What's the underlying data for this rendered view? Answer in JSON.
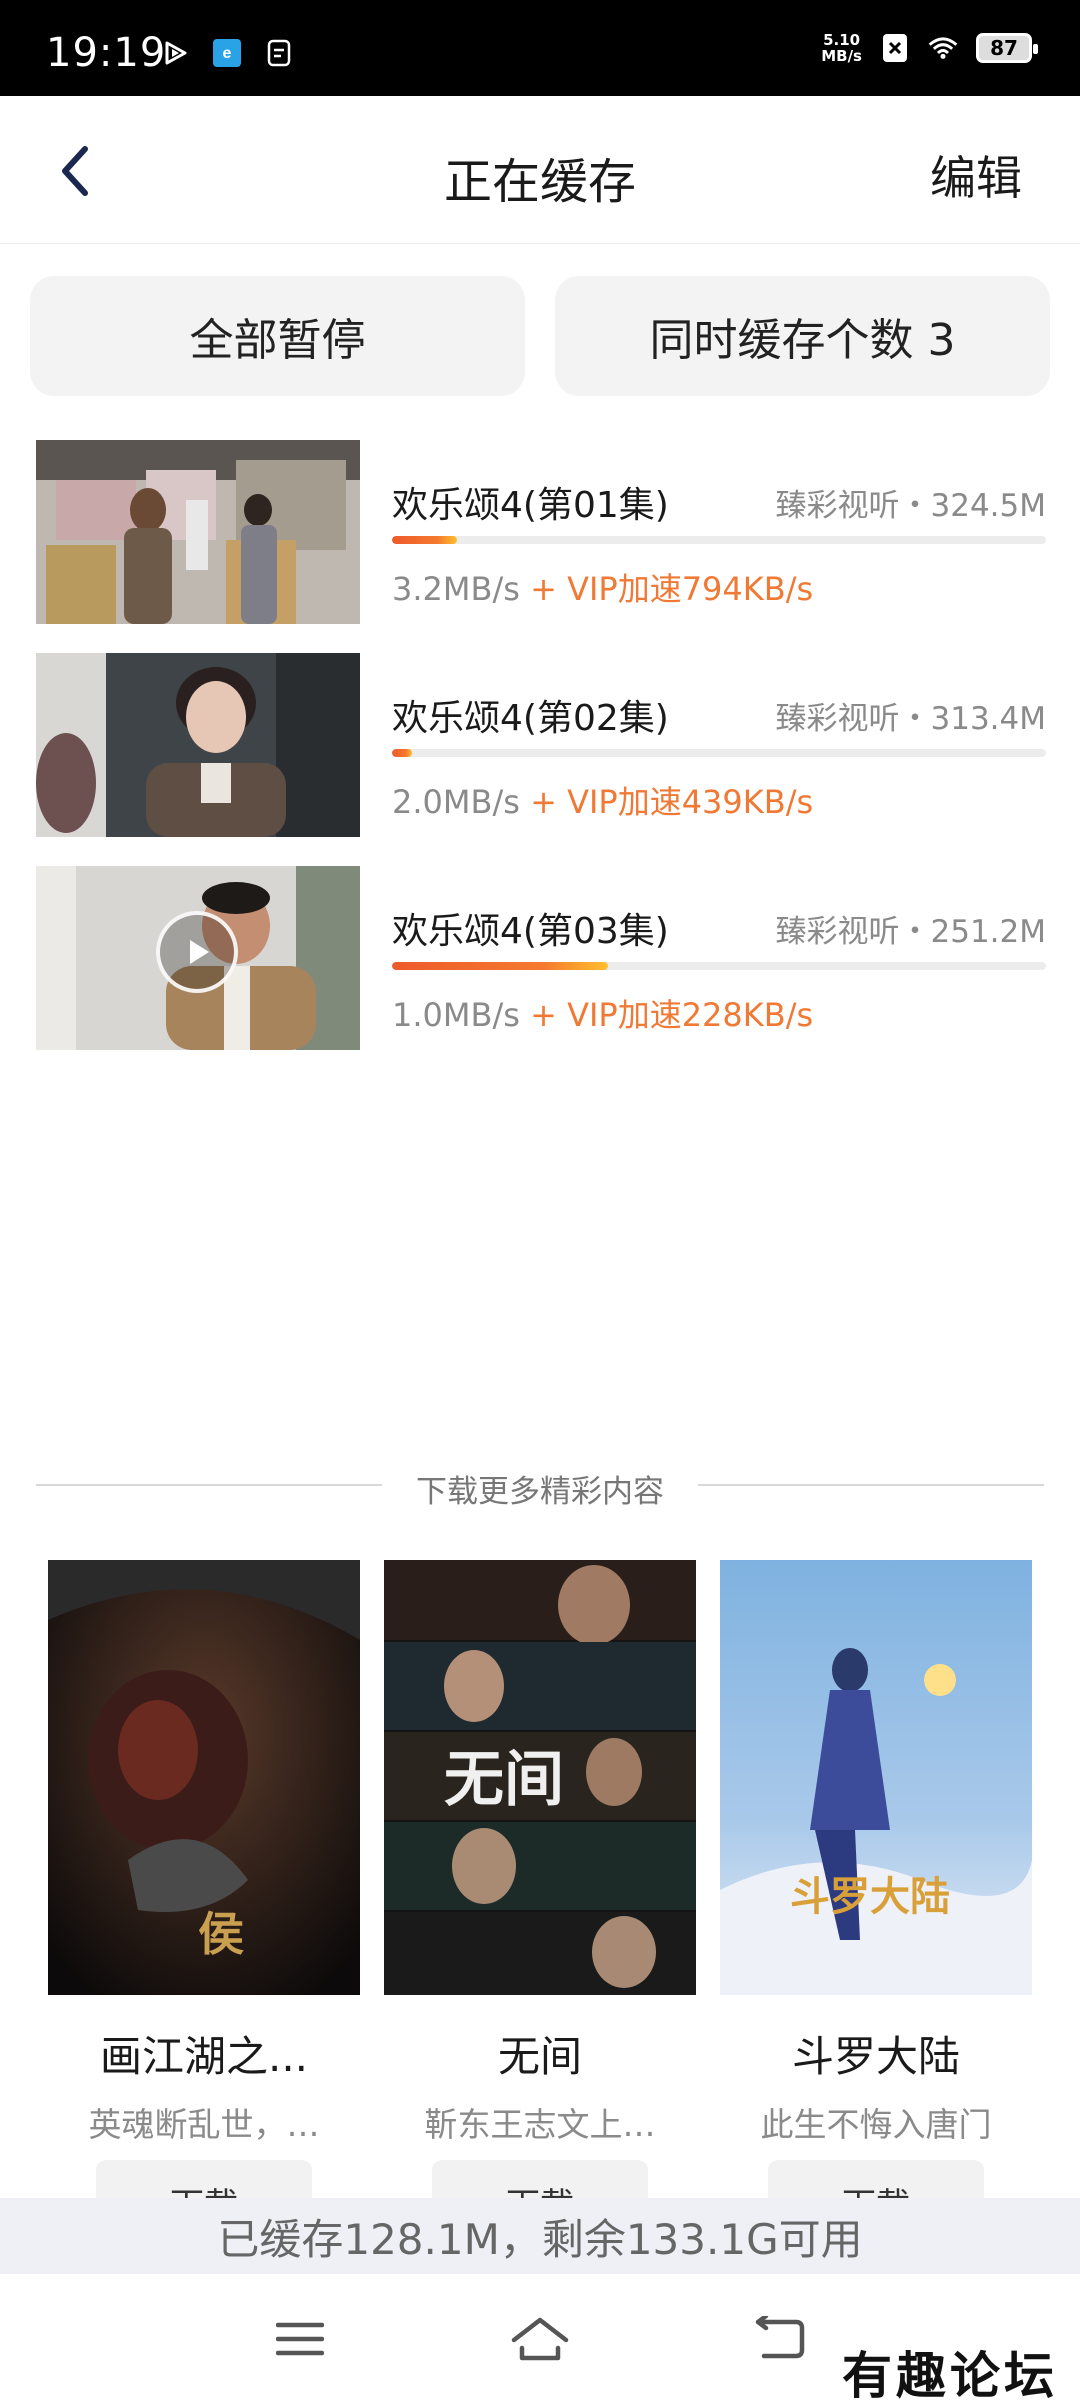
{
  "status_bar": {
    "time": "19:19",
    "net_speed_value": "5.10",
    "net_speed_unit": "MB/s",
    "battery": "87"
  },
  "header": {
    "title": "正在缓存",
    "edit_label": "编辑"
  },
  "controls": {
    "pause_all_label": "全部暂停",
    "concurrent_label": "同时缓存个数 3"
  },
  "downloads": [
    {
      "title": "欢乐颂4(第01集)",
      "meta": "臻彩视听・324.5M",
      "speed": "3.2MB/s",
      "vip_speed": " + VIP加速794KB/s",
      "progress": 0.1
    },
    {
      "title": "欢乐颂4(第02集)",
      "meta": "臻彩视听・313.4M",
      "speed": "2.0MB/s",
      "vip_speed": " + VIP加速439KB/s",
      "progress": 0.03
    },
    {
      "title": "欢乐颂4(第03集)",
      "meta": "臻彩视听・251.2M",
      "speed": "1.0MB/s",
      "vip_speed": " + VIP加速228KB/s",
      "progress": 0.33
    }
  ],
  "recommend": {
    "section_label": "下载更多精彩内容",
    "items": [
      {
        "title": "画江湖之...",
        "desc": "英魂断乱世，…",
        "button": "下载"
      },
      {
        "title": "无间",
        "desc": "靳东王志文上…",
        "button": "下载"
      },
      {
        "title": "斗罗大陆",
        "desc": "此生不悔入唐门",
        "button": "下载"
      }
    ]
  },
  "storage": {
    "text": "已缓存128.1M，剩余133.1G可用"
  },
  "watermark": "有趣论坛",
  "colors": {
    "accent": "#f07a35",
    "progress_start": "#ee5a2b",
    "progress_end": "#ffbf2f",
    "storage_bg": "#eef0f5"
  }
}
